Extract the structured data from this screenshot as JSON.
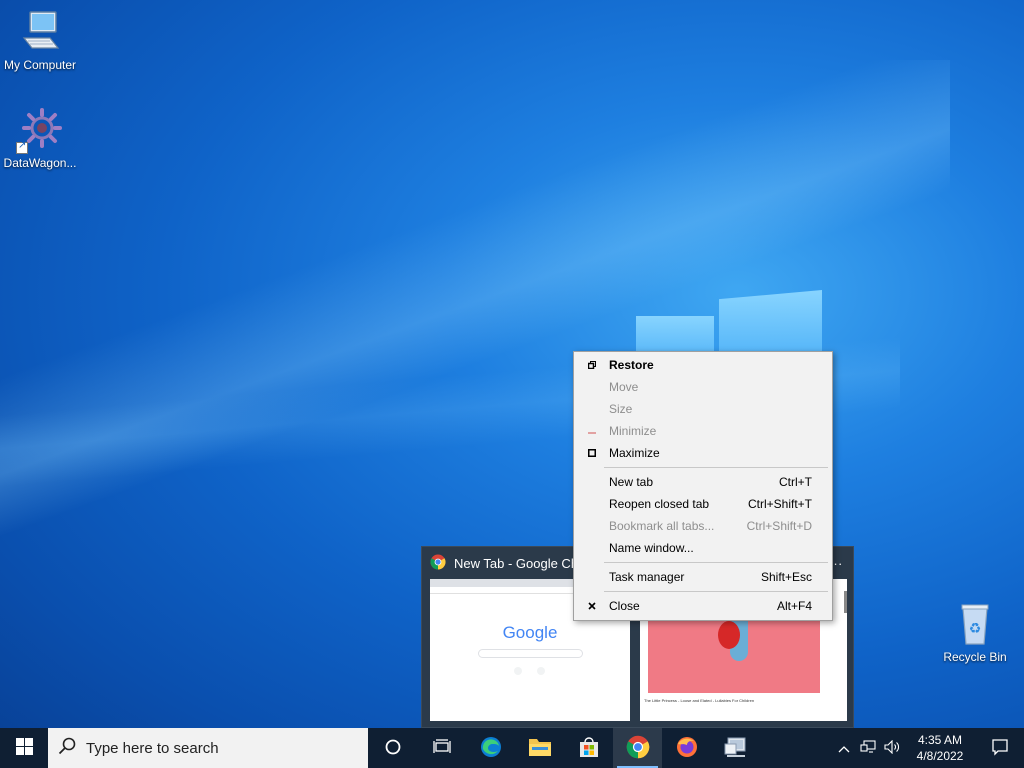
{
  "desktop": {
    "icons": [
      {
        "label": "My Computer",
        "icon": "monitor-icon"
      },
      {
        "label": "DataWagon...",
        "icon": "gear-logo-icon"
      },
      {
        "label": "Recycle Bin",
        "icon": "recycle-bin-icon"
      }
    ]
  },
  "context_menu": {
    "items": [
      {
        "label": "Restore",
        "shortcut": "",
        "icon": "restore-icon",
        "disabled": false,
        "bold": true
      },
      {
        "label": "Move",
        "shortcut": "",
        "icon": "",
        "disabled": true
      },
      {
        "label": "Size",
        "shortcut": "",
        "icon": "",
        "disabled": true
      },
      {
        "label": "Minimize",
        "shortcut": "",
        "icon": "minimize-icon",
        "disabled": true
      },
      {
        "label": "Maximize",
        "shortcut": "",
        "icon": "maximize-icon",
        "disabled": false
      },
      {
        "label": "New tab",
        "shortcut": "Ctrl+T",
        "icon": "",
        "disabled": false
      },
      {
        "label": "Reopen closed tab",
        "shortcut": "Ctrl+Shift+T",
        "icon": "",
        "disabled": false
      },
      {
        "label": "Bookmark all tabs...",
        "shortcut": "Ctrl+Shift+D",
        "icon": "",
        "disabled": true
      },
      {
        "label": "Name window...",
        "shortcut": "",
        "icon": "",
        "disabled": false
      },
      {
        "label": "Task manager",
        "shortcut": "Shift+Esc",
        "icon": "",
        "disabled": false
      },
      {
        "label": "Close",
        "shortcut": "Alt+F4",
        "icon": "close-icon",
        "disabled": false
      }
    ]
  },
  "preview": {
    "title": "New Tab - Google Chro",
    "more": "...",
    "thumb1": {
      "logo": "Google"
    },
    "thumb2": {
      "caption": "The Little Princess - Loose and Elated - Lullabies For Children"
    }
  },
  "taskbar": {
    "search_placeholder": "Type here to search",
    "apps": [
      "cortana-icon",
      "task-view-icon",
      "edge-icon",
      "file-explorer-icon",
      "store-icon",
      "chrome-icon",
      "firefox-icon",
      "network-app-icon"
    ],
    "active_app": "chrome-icon",
    "clock_time": "4:35 AM",
    "clock_date": "4/8/2022"
  },
  "colors": {
    "taskbar_bg": "#0f1f33",
    "menu_bg": "#f2f2f2",
    "accent": "#7fbfff"
  }
}
